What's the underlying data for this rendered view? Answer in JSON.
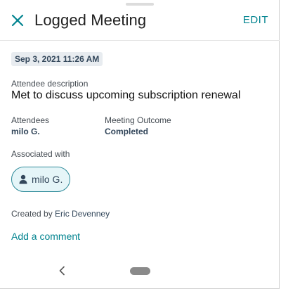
{
  "header": {
    "title": "Logged Meeting",
    "edit_label": "EDIT"
  },
  "activity": {
    "date": "Sep 3, 2021 11:26 AM",
    "description_label": "Attendee description",
    "description": "Met to discuss upcoming subscription renewal",
    "attendees_label": "Attendees",
    "attendees_value": "milo G.",
    "outcome_label": "Meeting Outcome",
    "outcome_value": "Completed",
    "associated_label": "Associated with",
    "associated_chip": "milo G.",
    "created_by_prefix": "Created by",
    "created_by_name": "Eric Devenney",
    "add_comment": "Add a comment"
  },
  "colors": {
    "accent": "#00838f",
    "chip_border": "#2d8a99",
    "chip_bg": "#e5f5f8",
    "date_chip_bg": "#e8ecf0"
  },
  "icons": {
    "close": "close-icon",
    "person": "person-icon",
    "back": "back-chevron-icon",
    "home": "home-pill"
  }
}
